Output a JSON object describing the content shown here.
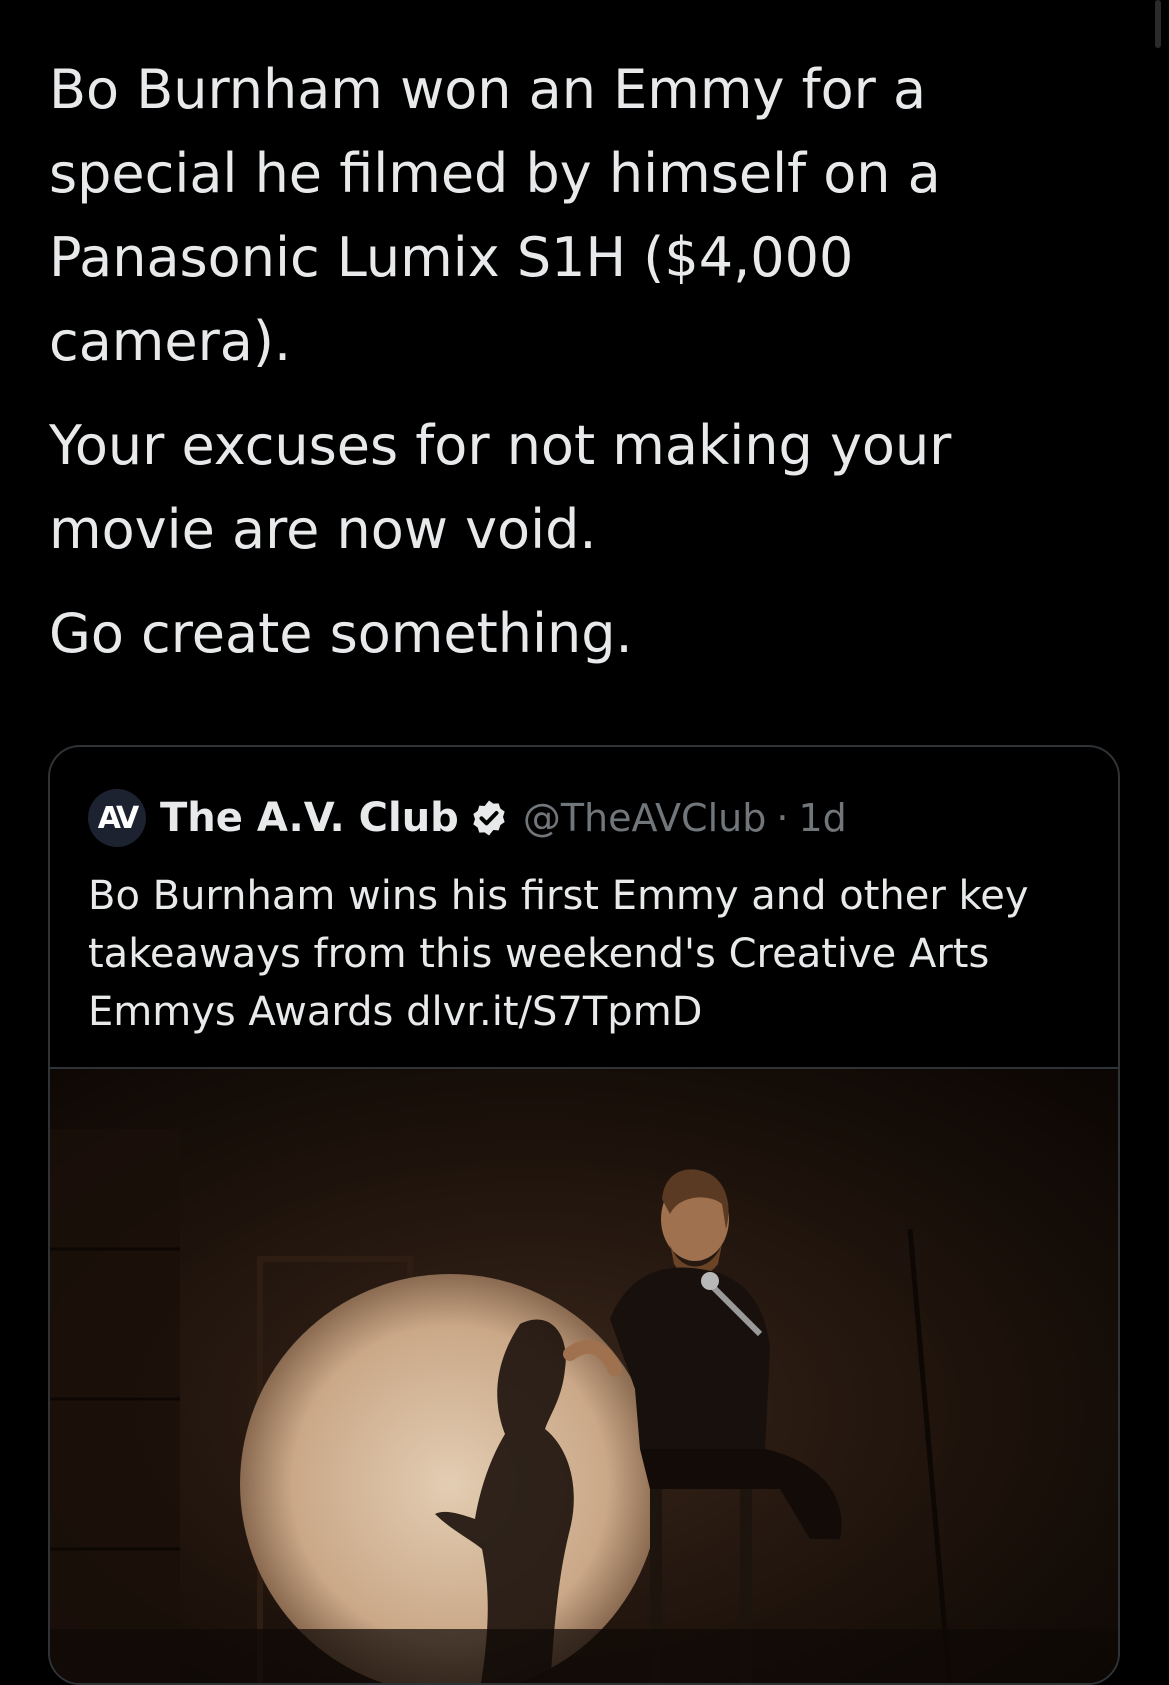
{
  "tweet": {
    "paragraphs": [
      "Bo Burnham won an Emmy for a special he filmed by himself on a Panasonic Lumix S1H ($4,000 camera).",
      "Your excuses for not making your movie are now void.",
      "Go create something."
    ]
  },
  "quoted_tweet": {
    "avatar_text": "AV",
    "display_name": "The A.V. Club",
    "verified_icon": "verified-badge-icon",
    "handle": "@TheAVClub",
    "separator": "·",
    "time": "1d",
    "text": "Bo Burnham wins his first Emmy and other key takeaways from this weekend's Creative Arts Emmys Awards dlvr.it/S7TpmD"
  },
  "colors": {
    "background": "#000000",
    "text": "#e7e9ea",
    "secondary_text": "#71767b",
    "border": "#2f3336"
  }
}
